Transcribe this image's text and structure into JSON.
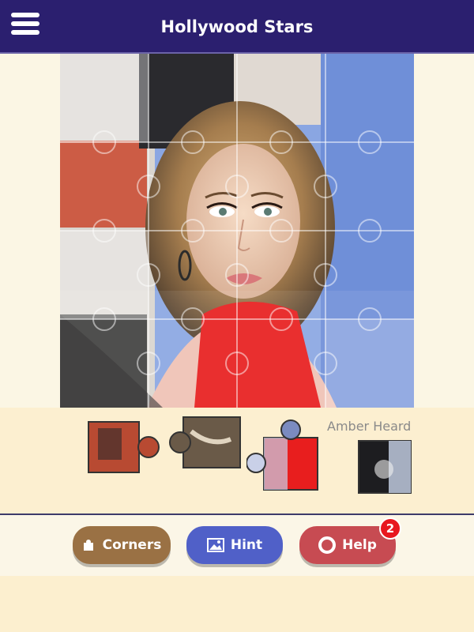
{
  "header": {
    "title": "Hollywood Stars",
    "menu_icon": "hamburger-menu-icon"
  },
  "tray": {
    "label": "Amber Heard"
  },
  "buttons": {
    "corners": {
      "label": "Corners",
      "icon": "puzzle-piece-icon"
    },
    "hint": {
      "label": "Hint",
      "icon": "image-icon"
    },
    "help": {
      "label": "Help",
      "icon": "life-ring-icon",
      "badge": "2"
    }
  },
  "colors": {
    "header_bg": "#2b1f6f",
    "corners_btn": "#9a7144",
    "hint_btn": "#5060c8",
    "help_btn": "#c74b52",
    "badge": "#e8171f"
  }
}
